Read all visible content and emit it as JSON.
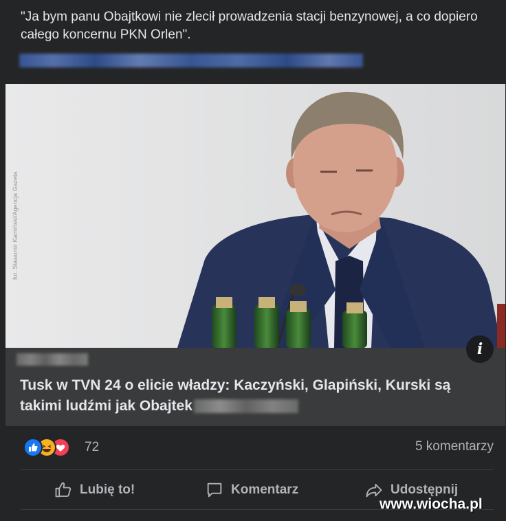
{
  "post": {
    "text": "\"Ja bym panu Obajtkowi nie zlecił prowadzenia stacji benzynowej, a co dopiero całego koncernu PKN Orlen\".",
    "link_blurred": true
  },
  "photo": {
    "credit": "fot. Sławomir Kamiński/Agencja Gazeta",
    "info_icon": "info-icon"
  },
  "link_preview": {
    "headline": "Tusk w TVN 24 o elicie władzy: Kaczyński, Glapiński, Kurski są takimi ludźmi jak Obajtek"
  },
  "stats": {
    "reactions": [
      "like-icon",
      "haha-icon",
      "love-icon"
    ],
    "reaction_count": "72",
    "comments": "5 komentarzy"
  },
  "actions": {
    "like": "Lubię to!",
    "comment": "Komentarz",
    "share": "Udostępnij"
  },
  "watermark": "www.wiocha.pl",
  "colors": {
    "background": "#242526",
    "link_box": "#3a3b3c",
    "like_blue": "#1877f2",
    "haha_yellow": "#f7b125",
    "love_red": "#f33e58"
  }
}
